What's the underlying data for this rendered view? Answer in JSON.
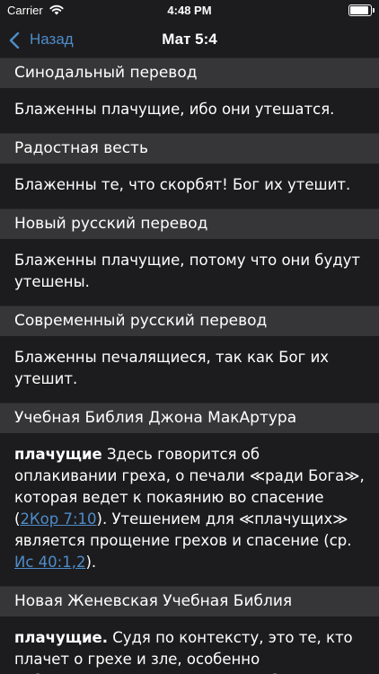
{
  "status_bar": {
    "carrier": "Carrier",
    "time": "4:48 PM",
    "battery_level": 1.0
  },
  "nav": {
    "back_label": "Назад",
    "title": "Мат 5:4"
  },
  "sections": [
    {
      "header": "Синодальный перевод",
      "text": "Блаженны плачущие, ибо они утешатся."
    },
    {
      "header": "Радостная весть",
      "text": "Блаженны те, что скорбят!  Бог их утешит."
    },
    {
      "header": "Новый русский перевод",
      "text": "Блаженны плачущие, потому что они будут утешены."
    },
    {
      "header": "Современный русский перевод",
      "text": "Блаженны печалящиеся, так как Бог их утешит."
    },
    {
      "header": "Учебная Библия Джона МакАртура",
      "term": "плачущие",
      "text_1": " Здесь говорится об оплакивании греха, о печали ≪ради Бога≫, которая ведет к покаянию во спасение (",
      "ref_1": "2Кор 7:10",
      "text_2": "). Утешением для ≪плачущих≫ является прощение грехов и спасение (ср. ",
      "ref_2": "Ис 40:1,2",
      "text_3": ")."
    },
    {
      "header": "Новая Женевская Учебная Библия",
      "term": "плачущие.",
      "text": " Судя по контексту, это те, кто плачет о грехе и зле, особенно собственном, а также о неспособности"
    }
  ],
  "colors": {
    "background": "#1c1c1e",
    "header_bg": "#363638",
    "link": "#4f8cc9"
  },
  "icons": [
    "wifi-icon",
    "battery-icon",
    "chevron-left-icon"
  ]
}
